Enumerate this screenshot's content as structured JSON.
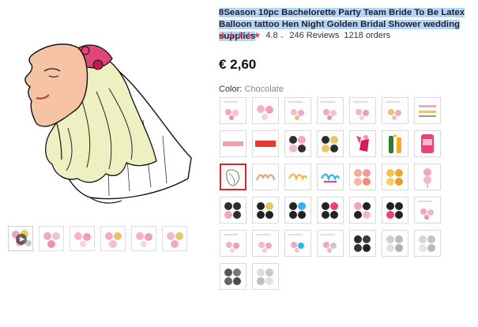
{
  "product": {
    "title": "8Season 10pc Bachelorette Party Team Bride To Be Latex Balloon tattoo Hen Night Golden Bridal Shower wedding supplies",
    "rating": "4.8",
    "reviews": "246 Reviews",
    "orders": "1218 orders",
    "price": "€ 2,60",
    "color_label": "Color:",
    "color_value": "Chocolate"
  },
  "icons": {
    "star": "star-icon",
    "chevron": "chevron-down-icon",
    "play": "play-icon"
  },
  "colors": {
    "accent": "#e0242f",
    "star": "#f5413c",
    "selection_highlight": "#b3d4fc"
  }
}
